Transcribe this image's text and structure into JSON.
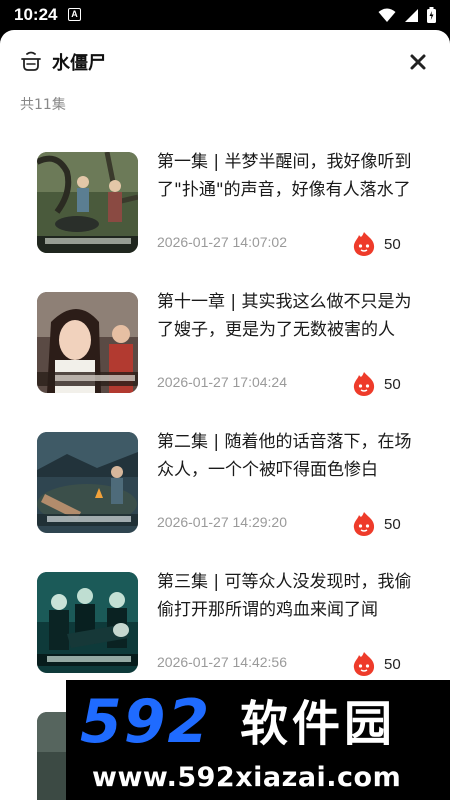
{
  "status_bar": {
    "time": "10:24",
    "notification_letter": "A"
  },
  "header": {
    "title": "水僵尸",
    "episode_count": "共11集"
  },
  "episodes": [
    {
      "title": "第一集 | 半梦半醒间，我好像听到了\"扑通\"的声音，好像有人落水了",
      "date": "2026-01-27 14:07:02",
      "heat": "50"
    },
    {
      "title": "第十一章 | 其实我这么做不只是为了嫂子，更是为了无数被害的人",
      "date": "2026-01-27 17:04:24",
      "heat": "50"
    },
    {
      "title": "第二集 | 随着他的话音落下，在场众人，一个个被吓得面色惨白",
      "date": "2026-01-27 14:29:20",
      "heat": "50"
    },
    {
      "title": "第三集 | 可等众人没发现时，我偷偷打开那所谓的鸡血来闻了闻",
      "date": "2026-01-27 14:42:56",
      "heat": "50"
    }
  ],
  "watermark": {
    "logo_text": "592软件园",
    "url": "www.592xiazai.com"
  },
  "colors": {
    "brand_blue": "#1f6bff",
    "heat_red": "#ee3b2a"
  }
}
